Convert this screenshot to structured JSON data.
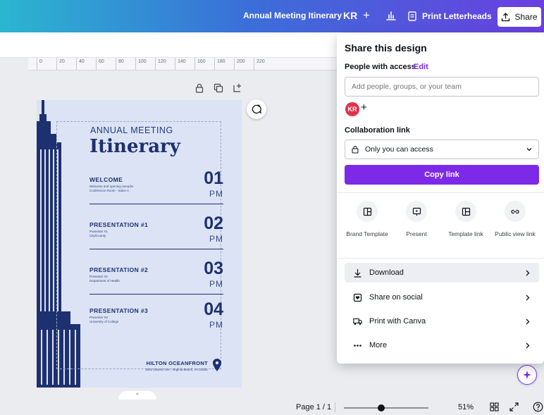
{
  "topbar": {
    "title": "Annual Meeting Itinerary",
    "avatar_initials": "KR",
    "plus": "+",
    "print_label": "Print Letterheads",
    "share_label": "Share"
  },
  "ruler": {
    "ticks": [
      "0",
      "20",
      "40",
      "60",
      "80",
      "100",
      "120",
      "140",
      "160",
      "180",
      "200",
      "220"
    ]
  },
  "design": {
    "heading_small": "ANNUAL MEETING",
    "heading_large": "Itinerary",
    "items": [
      {
        "title": "WELCOME",
        "sub1": "Welcome and opening remarks",
        "sub2": "Conference Room - Salon A",
        "num": "01",
        "pm": "PM"
      },
      {
        "title": "PRESENTATION #1",
        "sub1": "Presenter #1",
        "sub2": "City/County",
        "num": "02",
        "pm": "PM"
      },
      {
        "title": "PRESENTATION #2",
        "sub1": "Presenter #2",
        "sub2": "Department of Health",
        "num": "03",
        "pm": "PM"
      },
      {
        "title": "PRESENTATION #3",
        "sub1": "Presenter #3",
        "sub2": "University of College",
        "num": "04",
        "pm": "PM"
      }
    ],
    "venue": "HILTON OCEANFRONT",
    "address": "3001 Atlantic Ave., Virginia Beach, VA 23451"
  },
  "share_panel": {
    "title": "Share this design",
    "people_label": "People with access",
    "edit_label": "Edit",
    "input_placeholder": "Add people, groups, or your team",
    "avatar": "KR",
    "add": "+",
    "collab_label": "Collaboration link",
    "access_value": "Only you can access",
    "copy_label": "Copy link",
    "options": [
      {
        "label": "Brand Template",
        "icon": "brand-template-icon"
      },
      {
        "label": "Present",
        "icon": "present-icon"
      },
      {
        "label": "Template link",
        "icon": "template-link-icon"
      },
      {
        "label": "Public view link",
        "icon": "public-link-icon"
      }
    ],
    "actions": [
      {
        "label": "Download",
        "icon": "download-icon"
      },
      {
        "label": "Share on social",
        "icon": "social-icon"
      },
      {
        "label": "Print with Canva",
        "icon": "truck-icon"
      },
      {
        "label": "More",
        "icon": "more-icon"
      }
    ]
  },
  "bottombar": {
    "page_indicator": "Page 1 / 1",
    "zoom": "51%",
    "zoom_level": 0.51
  },
  "colors": {
    "accent": "#7d2ae8",
    "design_bg": "#dbe3f5",
    "design_ink": "#1d3070"
  }
}
